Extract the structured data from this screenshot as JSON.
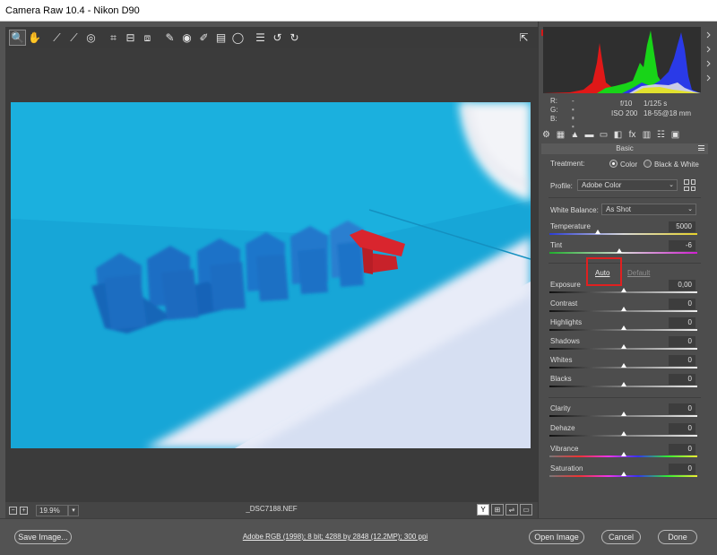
{
  "window": {
    "title": "Camera Raw 10.4  -  Nikon D90"
  },
  "toolbar": {
    "tools": [
      {
        "name": "zoom-tool-icon",
        "glyph": "🔍"
      },
      {
        "name": "hand-tool-icon",
        "glyph": "✋"
      },
      {
        "name": "white-balance-tool-icon",
        "glyph": "⟋"
      },
      {
        "name": "color-sampler-tool-icon",
        "glyph": "⟋"
      },
      {
        "name": "targeted-adjustment-tool-icon",
        "glyph": "◎"
      },
      {
        "name": "crop-tool-icon",
        "glyph": "⌗"
      },
      {
        "name": "straighten-tool-icon",
        "glyph": "⊟"
      },
      {
        "name": "transform-tool-icon",
        "glyph": "⧈"
      },
      {
        "name": "spot-removal-tool-icon",
        "glyph": "✎"
      },
      {
        "name": "red-eye-tool-icon",
        "glyph": "◉"
      },
      {
        "name": "adjustment-brush-icon",
        "glyph": "✐"
      },
      {
        "name": "graduated-filter-icon",
        "glyph": "▤"
      },
      {
        "name": "radial-filter-icon",
        "glyph": "◯"
      },
      {
        "name": "preferences-icon",
        "glyph": "☰"
      },
      {
        "name": "rotate-left-icon",
        "glyph": "↺"
      },
      {
        "name": "rotate-right-icon",
        "glyph": "↻"
      }
    ],
    "export_glyph": "⇱"
  },
  "readout": {
    "r_label": "R:",
    "r_value": "---",
    "g_label": "G:",
    "g_value": "---",
    "b_label": "B:",
    "b_value": "---",
    "aperture": "f/10",
    "shutter": "1/125 s",
    "iso": "ISO 200",
    "lens": "18-55@18 mm"
  },
  "panel": {
    "title": "Basic",
    "tabs": [
      "⚙",
      "▦",
      "▲",
      "▬",
      "▭",
      "◧",
      "fx",
      "▥",
      "☷",
      "▣"
    ],
    "treatment_label": "Treatment:",
    "treatment_options": [
      "Color",
      "Black & White"
    ],
    "treatment_selected": "Color",
    "profile_label": "Profile:",
    "profile_value": "Adobe Color",
    "wb_label": "White Balance:",
    "wb_value": "As Shot",
    "auto_label": "Auto",
    "default_label": "Default",
    "sliders": [
      {
        "key": "temperature",
        "label": "Temperature",
        "value": "5000",
        "pos": 0.33,
        "gradient": "linear-gradient(90deg,#2a3cd6,#d8d8d8,#e6d22a)"
      },
      {
        "key": "tint",
        "label": "Tint",
        "value": "-6",
        "pos": 0.47,
        "gradient": "linear-gradient(90deg,#1fae2c,#d8d8d8,#d01fd0)"
      },
      {
        "key": "exposure",
        "label": "Exposure",
        "value": "0,00",
        "pos": 0.5,
        "gradient": "linear-gradient(90deg,#111,#eee)"
      },
      {
        "key": "contrast",
        "label": "Contrast",
        "value": "0",
        "pos": 0.5,
        "gradient": "linear-gradient(90deg,#111,#eee)"
      },
      {
        "key": "highlights",
        "label": "Highlights",
        "value": "0",
        "pos": 0.5,
        "gradient": "linear-gradient(90deg,#111,#eee)"
      },
      {
        "key": "shadows",
        "label": "Shadows",
        "value": "0",
        "pos": 0.5,
        "gradient": "linear-gradient(90deg,#111,#eee)"
      },
      {
        "key": "whites",
        "label": "Whites",
        "value": "0",
        "pos": 0.5,
        "gradient": "linear-gradient(90deg,#111,#eee)"
      },
      {
        "key": "blacks",
        "label": "Blacks",
        "value": "0",
        "pos": 0.5,
        "gradient": "linear-gradient(90deg,#111,#eee)"
      },
      {
        "key": "clarity",
        "label": "Clarity",
        "value": "0",
        "pos": 0.5,
        "gradient": "linear-gradient(90deg,#111,#eee)"
      },
      {
        "key": "dehaze",
        "label": "Dehaze",
        "value": "0",
        "pos": 0.5,
        "gradient": "linear-gradient(90deg,#111,#eee)"
      },
      {
        "key": "vibrance",
        "label": "Vibrance",
        "value": "0",
        "pos": 0.5,
        "gradient": "linear-gradient(90deg,#777,#e33,#e3e,#33e,#3e3,#ee3)"
      },
      {
        "key": "saturation",
        "label": "Saturation",
        "value": "0",
        "pos": 0.5,
        "gradient": "linear-gradient(90deg,#777,#e33,#e3e,#33e,#3e3,#ee3)"
      }
    ]
  },
  "status": {
    "zoom_out": "−",
    "zoom_in": "+",
    "zoom": "19.9%",
    "filename": "_DSC7188.NEF",
    "view_buttons": [
      "Y",
      "⊞",
      "⇌",
      "▭"
    ]
  },
  "bottom": {
    "save_label": "Save Image...",
    "workflow_label": "Adobe RGB (1998); 8 bit; 4288 by 2848 (12.2MP); 300 ppi",
    "open_label": "Open Image",
    "cancel_label": "Cancel",
    "done_label": "Done"
  },
  "colors": {
    "highlight": "#e02020",
    "photo_bg": "#19a9d8",
    "house_blue": "#1a6fc4",
    "house_red": "#d8262f"
  }
}
